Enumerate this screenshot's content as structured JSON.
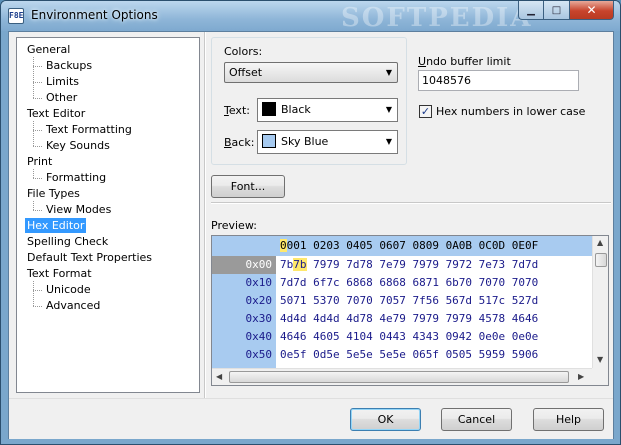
{
  "window": {
    "title": "Environment Options",
    "app_icon": "F8E",
    "watermark": "SOFTPEDIA",
    "minimize_glyph": "▁",
    "maximize_glyph": "□",
    "close_glyph": "✕"
  },
  "tree": {
    "items": [
      {
        "label": "General",
        "level": 0
      },
      {
        "label": "Backups",
        "level": 1
      },
      {
        "label": "Limits",
        "level": 1
      },
      {
        "label": "Other",
        "level": 1
      },
      {
        "label": "Text Editor",
        "level": 0
      },
      {
        "label": "Text Formatting",
        "level": 1
      },
      {
        "label": "Key Sounds",
        "level": 1
      },
      {
        "label": "Print",
        "level": 0
      },
      {
        "label": "Formatting",
        "level": 1
      },
      {
        "label": "File Types",
        "level": 0
      },
      {
        "label": "View Modes",
        "level": 1
      },
      {
        "label": "Hex Editor",
        "level": 0,
        "selected": true
      },
      {
        "label": "Spelling Check",
        "level": 0
      },
      {
        "label": "Default Text Properties",
        "level": 0
      },
      {
        "label": "Text Format",
        "level": 0
      },
      {
        "label": "Unicode",
        "level": 1
      },
      {
        "label": "Advanced",
        "level": 1
      }
    ]
  },
  "colors": {
    "label": "Colors:",
    "element_value": "Offset",
    "text_label_accel": "T",
    "text_label_rest": "ext:",
    "text_value": "Black",
    "text_swatch": "#000000",
    "back_label_accel": "B",
    "back_label_rest": "ack:",
    "back_value": "Sky Blue",
    "back_swatch": "#a6caf0"
  },
  "undo": {
    "label_accel": "U",
    "label_rest": "ndo buffer limit",
    "value": "1048576"
  },
  "hex_lower": {
    "checked": true,
    "check_glyph": "✓",
    "label": "Hex numbers in lower case"
  },
  "font_button": {
    "label": "Font..."
  },
  "preview": {
    "label": "Preview:",
    "header_cursor": "0",
    "header_rest": "001 0203 0405 0607 0809 0A0B 0C0D 0E0F",
    "rows": [
      {
        "offset": "0x00",
        "cursor": "7b",
        "lead": "7b",
        "rest": " 7979 7d78 7e79 7979 7972 7e73 7d7d"
      },
      {
        "offset": "0x10",
        "cursor": "",
        "lead": "",
        "rest": "7d7d 6f7c 6868 6868 6871 6b70 7070 7070"
      },
      {
        "offset": "0x20",
        "cursor": "",
        "lead": "",
        "rest": "5071 5370 7070 7057 7f56 567d 517c 527d"
      },
      {
        "offset": "0x30",
        "cursor": "",
        "lead": "",
        "rest": "4d4d 4d4d 4d78 4e79 7979 7979 4578 4646"
      },
      {
        "offset": "0x40",
        "cursor": "",
        "lead": "",
        "rest": "4646 4605 4104 0443 4343 0942 0e0e 0e0e"
      },
      {
        "offset": "0x50",
        "cursor": "",
        "lead": "",
        "rest": "0e5f 0d5e 5e5e 5e5e 065f 0505 5959 5906"
      }
    ]
  },
  "buttons": {
    "ok": "OK",
    "cancel": "Cancel",
    "help": "Help"
  },
  "colors_theme": {
    "selection": "#3399ff",
    "hex_header_bg": "#a8cbf0",
    "hex_text": "#1a1a8a",
    "cursor_highlight": "#ffe86b"
  },
  "icons": {
    "dropdown": "chevron-down-icon",
    "scroll_up": "scroll-up-icon",
    "scroll_down": "scroll-down-icon",
    "scroll_left": "scroll-left-icon",
    "scroll_right": "scroll-right-icon"
  }
}
